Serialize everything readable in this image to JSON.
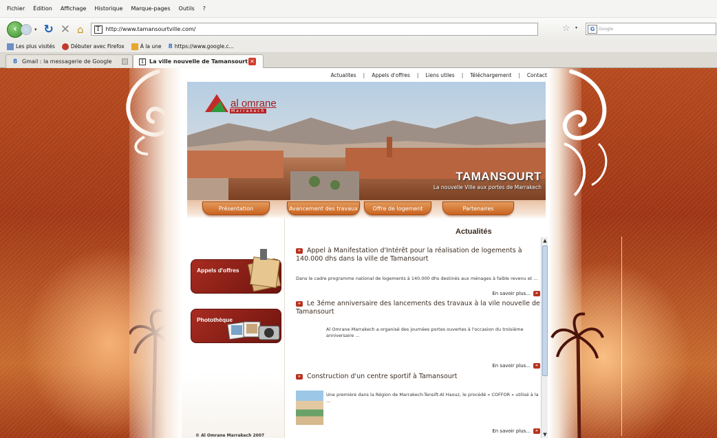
{
  "browser": {
    "menu": [
      "Fichier",
      "Édition",
      "Affichage",
      "Historique",
      "Marque-pages",
      "Outils",
      "?"
    ],
    "url": "http://www.tamansourtville.com/",
    "search_placeholder": "Google",
    "bookmarks": [
      "Les plus visités",
      "Débuter avec Firefox",
      "À la une",
      "https://www.google.c..."
    ],
    "tabs": [
      "Gmail : la messagerie de Google",
      "La ville nouvelle de Tamansourt"
    ]
  },
  "site": {
    "top_links": [
      "Actualites",
      "Appels d'offres",
      "Liens utiles",
      "Téléchargement",
      "Contact"
    ],
    "separator": "|",
    "logo_name": "al omrane",
    "logo_city": "Marrakech",
    "brand_title": "TAMANSOURT",
    "brand_subtitle": "La nouvelle Ville aux portes de Marrakech",
    "nav": [
      "Présentation",
      "Avancement des travaux",
      "Offre de logement",
      "Partenaires"
    ],
    "news_heading": "Actualités",
    "left_promos": [
      "Appels d'offres",
      "Photothèque"
    ],
    "copyright": "© Al Omrane Marrakech  2007",
    "read_more": "En savoir plus...",
    "news": [
      {
        "title": "Appel à Manifestation d'Intérêt pour la réalisation de logements à 140.000 dhs dans la ville de Tamansourt",
        "text": "Dans le cadre programme national de logements à 140.000 dhs destinés aux ménages à faible revenu et ..."
      },
      {
        "title": "Le 3éme anniversaire des lancements des travaux à la vile nouvelle de Tamansourt",
        "text": "Al Omrane Marrakech a organisé des journées portes ouvertes à l'occasion du troisième anniversaire ..."
      },
      {
        "title": "Construction d'un centre sportif à Tamansourt",
        "text": "Une première dans la Région de Marrakech-Tensift-Al Haouz, le procédé « COFFOR » utilisé à la ..."
      }
    ]
  },
  "colors": {
    "accent": "#b8321f",
    "nav_orange": "#d6772f",
    "bg_rust": "#a33a16"
  }
}
